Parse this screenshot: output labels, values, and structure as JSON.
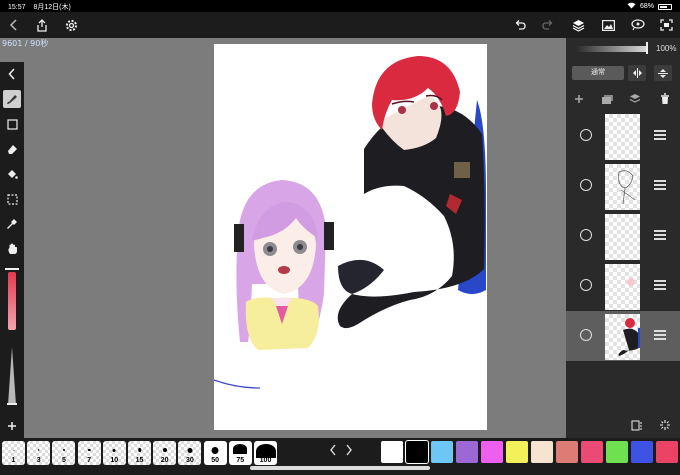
{
  "status": {
    "time": "15:57",
    "date": "8月12日(木)",
    "battery": "68%",
    "battery_level": 0.68
  },
  "workspace": {
    "counter": "9601 / 90秒"
  },
  "layers_panel": {
    "opacity_value": "100%",
    "opacity_level": 1.0,
    "blend_mode": "通常",
    "layers": [
      {
        "name": "layer-5",
        "selected": false
      },
      {
        "name": "layer-4",
        "selected": false
      },
      {
        "name": "layer-3",
        "selected": false
      },
      {
        "name": "layer-2",
        "selected": false
      },
      {
        "name": "layer-1",
        "selected": true
      }
    ]
  },
  "brush_sizes": [
    "1",
    "3",
    "5",
    "7",
    "10",
    "15",
    "20",
    "30",
    "50",
    "75",
    "100"
  ],
  "palette": [
    "#ffffff",
    "#000000",
    "#6ec6f5",
    "#9b68d6",
    "#ef5fef",
    "#f3f15a",
    "#f6e4d0",
    "#dc7c74",
    "#ea4a74",
    "#6fe04f",
    "#3f52e6",
    "#ea4364"
  ],
  "icons": {
    "toolbar": [
      "back-icon",
      "share-icon",
      "gear-icon",
      "undo-icon",
      "redo-icon",
      "layers-icon",
      "image-icon",
      "material-icon",
      "fullscreen-icon"
    ],
    "tools": [
      "collapse-icon",
      "brush-icon",
      "rectangle-icon",
      "eraser-icon",
      "fill-icon",
      "select-icon",
      "eyedropper-icon",
      "hand-icon",
      "add-icon"
    ]
  }
}
